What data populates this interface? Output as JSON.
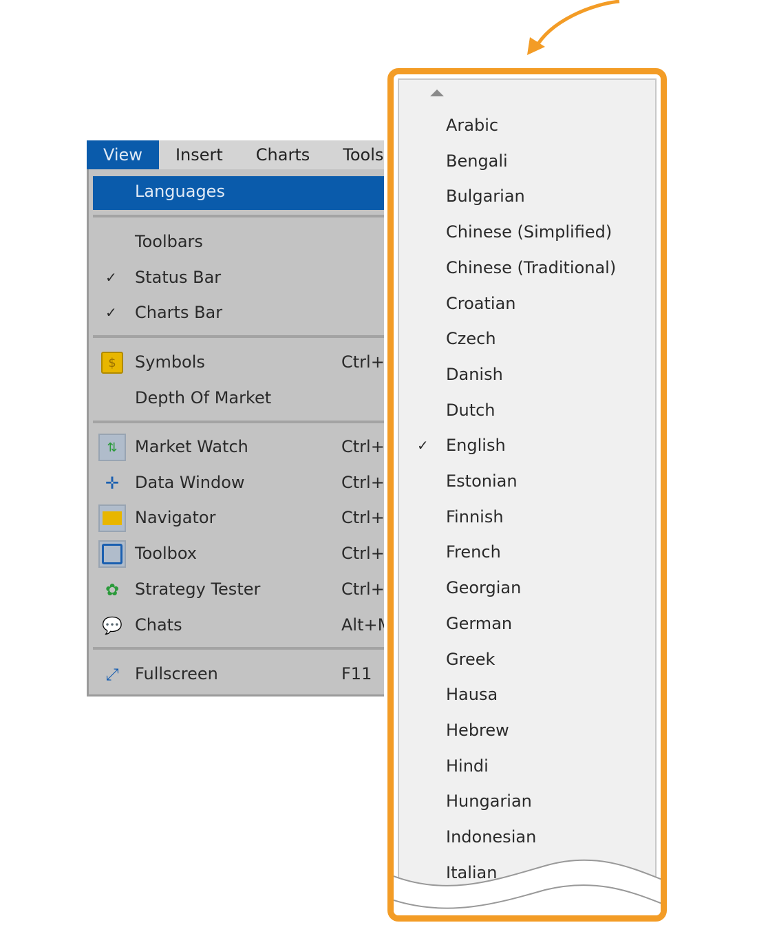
{
  "menubar": {
    "items": [
      "View",
      "Insert",
      "Charts",
      "Tools"
    ]
  },
  "view_menu": {
    "highlighted": "Languages",
    "group1": [
      {
        "label": "Toolbars",
        "checked": false
      },
      {
        "label": "Status Bar",
        "checked": true
      },
      {
        "label": "Charts Bar",
        "checked": true
      }
    ],
    "group2": [
      {
        "label": "Symbols",
        "shortcut": "Ctrl+",
        "icon": "dollar-icon"
      },
      {
        "label": "Depth Of Market",
        "shortcut": ""
      }
    ],
    "group3": [
      {
        "label": "Market Watch",
        "shortcut": "Ctrl+M",
        "icon": "market-watch-icon"
      },
      {
        "label": "Data Window",
        "shortcut": "Ctrl+",
        "icon": "crosshair-icon"
      },
      {
        "label": "Navigator",
        "shortcut": "Ctrl+N",
        "icon": "folder-icon"
      },
      {
        "label": "Toolbox",
        "shortcut": "Ctrl+",
        "icon": "toolbox-icon"
      },
      {
        "label": "Strategy Tester",
        "shortcut": "Ctrl+",
        "icon": "gear-check-icon"
      },
      {
        "label": "Chats",
        "shortcut": "Alt+M",
        "icon": "chat-icon"
      }
    ],
    "group4": [
      {
        "label": "Fullscreen",
        "shortcut": "F11",
        "icon": "expand-icon"
      }
    ],
    "check_glyph": "✓"
  },
  "languages": {
    "selected": "English",
    "items": [
      "Arabic",
      "Bengali",
      "Bulgarian",
      "Chinese (Simplified)",
      "Chinese (Traditional)",
      "Croatian",
      "Czech",
      "Danish",
      "Dutch",
      "English",
      "Estonian",
      "Finnish",
      "French",
      "Georgian",
      "German",
      "Greek",
      "Hausa",
      "Hebrew",
      "Hindi",
      "Hungarian",
      "Indonesian",
      "Italian"
    ]
  },
  "colors": {
    "accent": "#f39c26",
    "highlight": "#0a5bab"
  }
}
